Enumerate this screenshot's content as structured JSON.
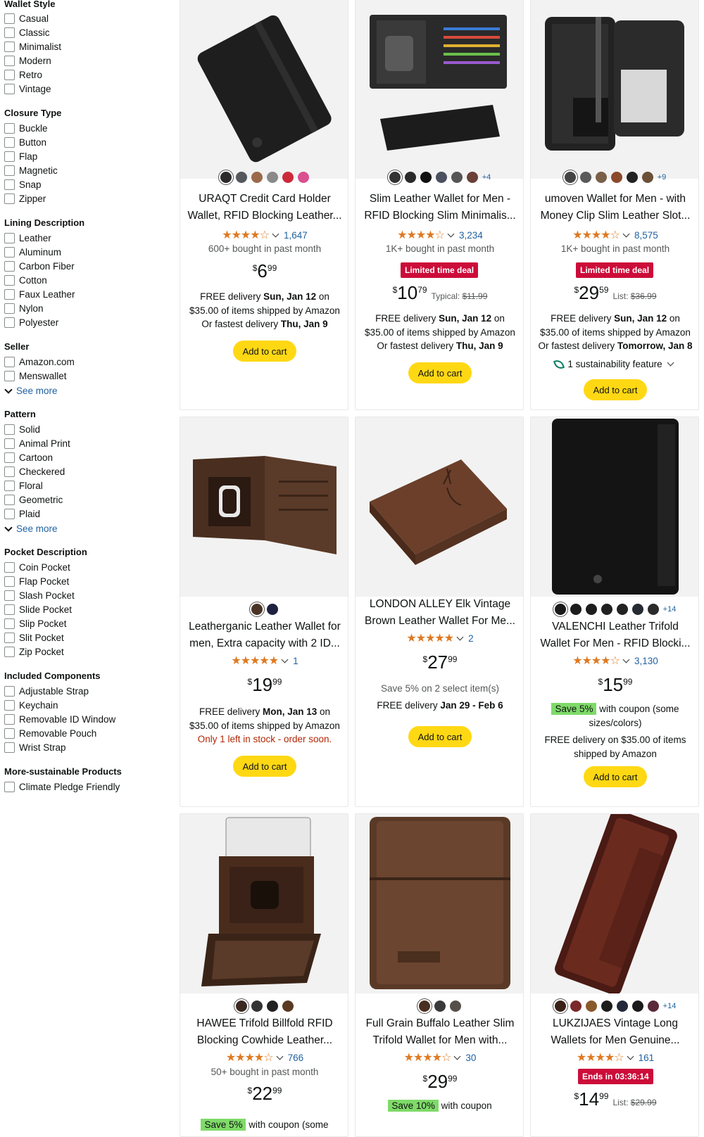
{
  "sidebar": {
    "wallet_style": {
      "title": "Wallet Style",
      "options": [
        "Casual",
        "Classic",
        "Minimalist",
        "Modern",
        "Retro",
        "Vintage"
      ]
    },
    "closure_type": {
      "title": "Closure Type",
      "options": [
        "Buckle",
        "Button",
        "Flap",
        "Magnetic",
        "Snap",
        "Zipper"
      ]
    },
    "lining": {
      "title": "Lining Description",
      "options": [
        "Leather",
        "Aluminum",
        "Carbon Fiber",
        "Cotton",
        "Faux Leather",
        "Nylon",
        "Polyester"
      ]
    },
    "seller": {
      "title": "Seller",
      "options": [
        "Amazon.com",
        "Menswallet"
      ],
      "see_more": "See more"
    },
    "pattern": {
      "title": "Pattern",
      "options": [
        "Solid",
        "Animal Print",
        "Cartoon",
        "Checkered",
        "Floral",
        "Geometric",
        "Plaid"
      ],
      "see_more": "See more"
    },
    "pocket": {
      "title": "Pocket Description",
      "options": [
        "Coin Pocket",
        "Flap Pocket",
        "Slash Pocket",
        "Slide Pocket",
        "Slip Pocket",
        "Slit Pocket",
        "Zip Pocket"
      ]
    },
    "components": {
      "title": "Included Components",
      "options": [
        "Adjustable Strap",
        "Keychain",
        "Removable ID Window",
        "Removable Pouch",
        "Wrist Strap"
      ]
    },
    "sustainable": {
      "title": "More-sustainable Products",
      "options": [
        "Climate Pledge Friendly"
      ]
    }
  },
  "products": [
    {
      "title": "URAQT Credit Card Holder Wallet, RFID Blocking Leather...",
      "swatches": [
        "#2b2b2b",
        "#55585c",
        "#9b6a4a",
        "#8a8a8a",
        "#cc2a3a",
        "#d94f90"
      ],
      "swatch_more": "",
      "stars": "★★★★☆",
      "rating": 4.4,
      "reviews": "1,647",
      "bought": "600+ bought in past month",
      "price_currency": "$",
      "price_whole": "6",
      "price_fraction": "99",
      "delivery_line1_pre": "FREE delivery ",
      "delivery_date": "Sun, Jan 12",
      "delivery_line1_post": " on",
      "delivery_line2": "$35.00 of items shipped by Amazon",
      "fastest_pre": "Or fastest delivery ",
      "fastest_date": "Thu, Jan 9",
      "add_to_cart": "Add to cart"
    },
    {
      "title": "Slim Leather Wallet for Men - RFID Blocking Slim Minimalis...",
      "swatches": [
        "#333333",
        "#2a2a2a",
        "#111111",
        "#4a5060",
        "#555555",
        "#6b4038"
      ],
      "swatch_more": "+4",
      "stars": "★★★★☆",
      "rating": 4.4,
      "reviews": "3,234",
      "bought": "1K+ bought in past month",
      "badge": "Limited time deal",
      "price_currency": "$",
      "price_whole": "10",
      "price_fraction": "79",
      "typical_label": "Typical: ",
      "typical_price": "$11.99",
      "delivery_line1_pre": "FREE delivery ",
      "delivery_date": "Sun, Jan 12",
      "delivery_line1_post": " on",
      "delivery_line2": "$35.00 of items shipped by Amazon",
      "fastest_pre": "Or fastest delivery ",
      "fastest_date": "Thu, Jan 9",
      "add_to_cart": "Add to cart"
    },
    {
      "title": "umoven Wallet for Men - with Money Clip Slim Leather Slot...",
      "swatches": [
        "#444444",
        "#5a5a5a",
        "#7a6048",
        "#8b4a2b",
        "#222222",
        "#6b5038"
      ],
      "swatch_more": "+9",
      "stars": "★★★★☆",
      "rating": 4.4,
      "reviews": "8,575",
      "bought": "1K+ bought in past month",
      "badge": "Limited time deal",
      "price_currency": "$",
      "price_whole": "29",
      "price_fraction": "59",
      "typical_label": "List: ",
      "typical_price": "$36.99",
      "delivery_line1_pre": "FREE delivery ",
      "delivery_date": "Sun, Jan 12",
      "delivery_line1_post": " on",
      "delivery_line2": "$35.00 of items shipped by Amazon",
      "fastest_pre": "Or fastest delivery ",
      "fastest_date": "Tomorrow, Jan 8",
      "sustainability": "1 sustainability feature",
      "add_to_cart": "Add to cart"
    },
    {
      "title": "Leatherganic Leather Wallet for men, Extra capacity with 2 ID...",
      "swatches": [
        "#4a3426",
        "#1e2240"
      ],
      "swatch_more": "",
      "stars": "★★★★★",
      "rating": 4.8,
      "reviews": "1",
      "price_currency": "$",
      "price_whole": "19",
      "price_fraction": "99",
      "delivery_line1_pre": "FREE delivery ",
      "delivery_date": "Mon, Jan 13",
      "delivery_line1_post": " on",
      "delivery_line2": "$35.00 of items shipped by Amazon",
      "stock": "Only 1 left in stock - order soon.",
      "add_to_cart": "Add to cart"
    },
    {
      "title": "LONDON ALLEY Elk Vintage Brown Leather Wallet For Me...",
      "stars": "★★★★★",
      "rating": 5.0,
      "reviews": "2",
      "price_currency": "$",
      "price_whole": "27",
      "price_fraction": "99",
      "save_text": "Save 5% on 2 select item(s)",
      "delivery_line1_pre": "FREE delivery ",
      "delivery_date": "Jan 29 - Feb 6",
      "add_to_cart": "Add to cart"
    },
    {
      "title": "VALENCHI Leather Trifold Wallet For Men - RFID Blocki...",
      "swatches": [
        "#1a1a1a",
        "#1c1c1c",
        "#1e1e1e",
        "#202020",
        "#222222",
        "#252a33",
        "#2a2a2a"
      ],
      "swatch_more": "+14",
      "stars": "★★★★☆",
      "rating": 4.4,
      "reviews": "3,130",
      "price_currency": "$",
      "price_whole": "15",
      "price_fraction": "99",
      "coupon_badge": "Save 5%",
      "coupon_text": " with coupon (some sizes/colors)",
      "delivery_text": "FREE delivery on $35.00 of items shipped by Amazon",
      "add_to_cart": "Add to cart"
    },
    {
      "title": "HAWEE Trifold Billfold RFID Blocking Cowhide Leather...",
      "swatches": [
        "#3a2a20",
        "#333333",
        "#222222",
        "#5a3a22"
      ],
      "swatch_more": "",
      "stars": "★★★★☆",
      "rating": 4.4,
      "reviews": "766",
      "bought": "50+ bought in past month",
      "price_currency": "$",
      "price_whole": "22",
      "price_fraction": "99",
      "coupon_badge": "Save 5%",
      "coupon_text": " with coupon (some"
    },
    {
      "title": "Full Grain Buffalo Leather Slim Trifold Wallet for Men with...",
      "swatches": [
        "#4a3020",
        "#3a3a3a",
        "#55504a"
      ],
      "swatch_more": "",
      "stars": "★★★★☆",
      "rating": 4.5,
      "reviews": "30",
      "price_currency": "$",
      "price_whole": "29",
      "price_fraction": "99",
      "coupon_badge": "Save 10%",
      "coupon_text": " with coupon"
    },
    {
      "title": "LUKZIJAES Vintage Long Wallets for Men Genuine...",
      "swatches": [
        "#3a2218",
        "#7a2a2a",
        "#8b5a2b",
        "#1c1c1c",
        "#222a3a",
        "#1a1a1a",
        "#5a2a3a"
      ],
      "swatch_more": "+14",
      "stars": "★★★★☆",
      "rating": 4.4,
      "reviews": "161",
      "badge": "Ends in 03:36:14",
      "price_currency": "$",
      "price_whole": "14",
      "price_fraction": "99",
      "typical_label": "List: ",
      "typical_price": "$29.99"
    }
  ]
}
